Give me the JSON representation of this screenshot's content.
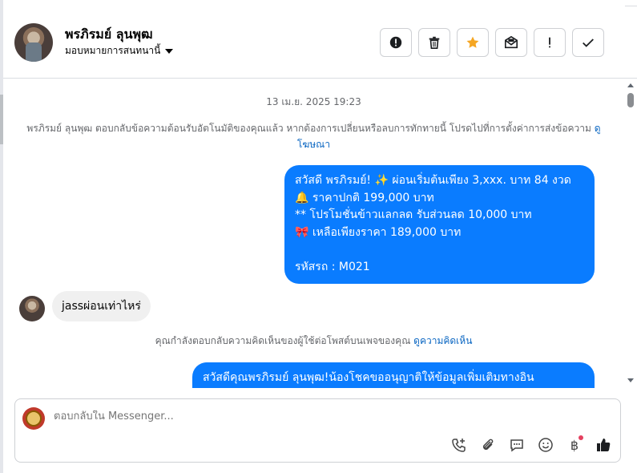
{
  "header": {
    "contact_name": "พรภิรมย์ ลุนพุฒ",
    "assign_label": "มอบหมายการสนทนานี้",
    "toolbar": [
      "report-icon",
      "trash-icon",
      "star-icon",
      "mark-read-icon",
      "follow-up-icon",
      "done-icon"
    ]
  },
  "thread": {
    "timestamp": "13 เม.ย. 2025 19:23",
    "system_note_1": "พรภิรมย์ ลุนพุฒ ตอบกลับข้อความต้อนรับอัตโนมัติของคุณแล้ว หากต้องการเปลี่ยนหรือลบการทักทายนี้ โปรดไปที่การตั้งค่าการส่งข้อความ",
    "system_note_1_link": "ดูโฆษณา",
    "outgoing_1": {
      "line1": "สวัสดี พรภิรมย์! ✨  ผ่อนเริ่มต้นเพียง 3,xxx. บาท 84 งวด",
      "line2": "🔔 ราคาปกติ 199,000 บาท",
      "line3": "** โปรโมชั่นข้าวแลกลด รับส่วนลด 10,000 บาท",
      "line4": "🎀  เหลือเพียงราคา 189,000 บาท",
      "line5": " รหัสรถ : M021"
    },
    "incoming_1": "jassผ่อนเท่าไหร่",
    "system_note_2": "คุณกำลังตอบกลับความคิดเห็นของผู้ใช้ต่อโพสต์บนเพจของคุณ",
    "system_note_2_link": "ดูความคิดเห็น",
    "outgoing_2": "สวัสดีคุณพรภิรมย์ ลุนพุฒ!น้องโชคขออนุญาติให้ข้อมูลเพิ่มเติมทางอิน"
  },
  "composer": {
    "placeholder": "ตอบกลับใน Messenger...",
    "baht_symbol": "฿",
    "icons": [
      "call-add-icon",
      "attach-icon",
      "saved-reply-icon",
      "emoji-icon",
      "payment-icon",
      "like-icon"
    ]
  },
  "colors": {
    "accent": "#0a7cff",
    "link": "#0a66c2",
    "muted": "#65676b",
    "star": "#f5a623"
  }
}
